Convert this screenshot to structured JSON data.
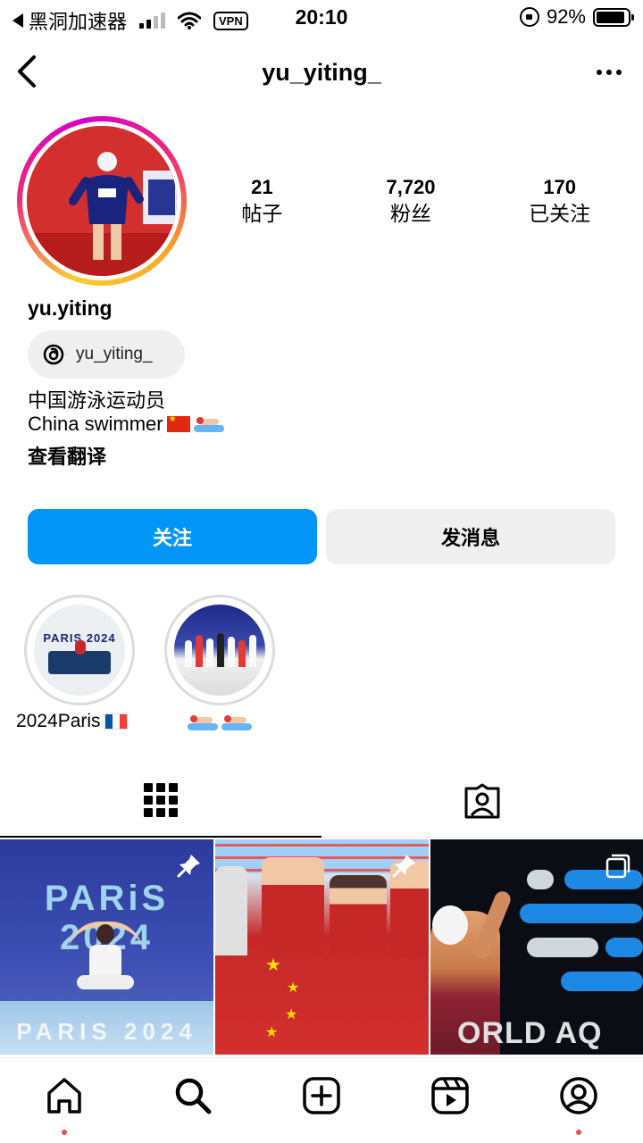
{
  "status_bar": {
    "carrier": "黑洞加速器",
    "vpn_label": "VPN",
    "time": "20:10",
    "battery": "92%",
    "battery_level": 0.92
  },
  "header": {
    "username": "yu_yiting_"
  },
  "profile": {
    "stats": [
      {
        "value": "21",
        "label": "帖子"
      },
      {
        "value": "7,720",
        "label": "粉丝"
      },
      {
        "value": "170",
        "label": "已关注"
      }
    ],
    "display_name": "yu.yiting",
    "threads_handle": "yu_yiting_",
    "bio_line1": "中国游泳运动员",
    "bio_line2": "China swimmer",
    "translate_link": "查看翻译"
  },
  "actions": {
    "follow_label": "关注",
    "message_label": "发消息"
  },
  "highlights": [
    {
      "label": "2024Paris",
      "image_text": "PARIS 2024"
    },
    {
      "label": ""
    }
  ],
  "posts": [
    {
      "title_line1": "PARiS",
      "title_line2": "2024",
      "floor_text": "PARIS 2024",
      "badge": "pin-icon"
    },
    {
      "badge": "pin-icon"
    },
    {
      "text": "ORLD AQ",
      "badge": "multiple-images-icon"
    }
  ],
  "tabs": [
    {
      "icon": "grid-icon",
      "active": true
    },
    {
      "icon": "tagged-icon",
      "active": false
    }
  ],
  "bottom_nav": [
    {
      "icon": "home-icon",
      "dot": true
    },
    {
      "icon": "search-icon",
      "dot": false
    },
    {
      "icon": "create-icon",
      "dot": false
    },
    {
      "icon": "reels-icon",
      "dot": false
    },
    {
      "icon": "profile-icon",
      "dot": true
    }
  ],
  "colors": {
    "primary_button": "#0095f6",
    "secondary_button": "#efefef",
    "notification_dot": "#ed4956"
  }
}
